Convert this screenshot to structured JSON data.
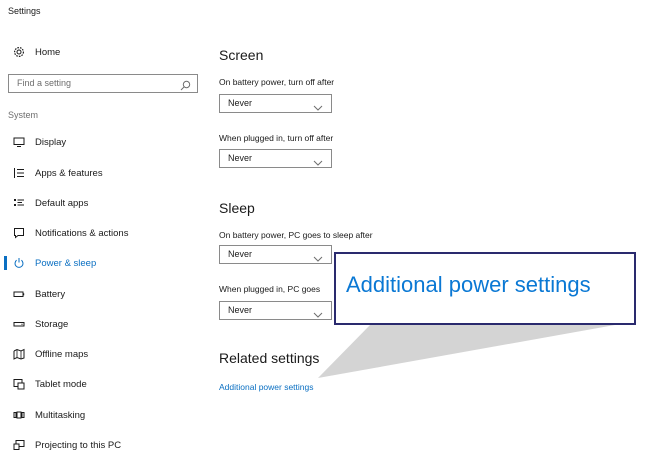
{
  "window": {
    "title": "Settings"
  },
  "sidebar": {
    "home_label": "Home",
    "search_placeholder": "Find a setting",
    "section_label": "System",
    "items": [
      {
        "label": "Display",
        "icon": "monitor-icon"
      },
      {
        "label": "Apps & features",
        "icon": "list-icon"
      },
      {
        "label": "Default apps",
        "icon": "default-apps-icon"
      },
      {
        "label": "Notifications & actions",
        "icon": "notification-icon"
      },
      {
        "label": "Power & sleep",
        "icon": "power-icon",
        "active": true
      },
      {
        "label": "Battery",
        "icon": "battery-icon"
      },
      {
        "label": "Storage",
        "icon": "storage-icon"
      },
      {
        "label": "Offline maps",
        "icon": "map-icon"
      },
      {
        "label": "Tablet mode",
        "icon": "tablet-icon"
      },
      {
        "label": "Multitasking",
        "icon": "multitasking-icon"
      },
      {
        "label": "Projecting to this PC",
        "icon": "projecting-icon"
      }
    ]
  },
  "main": {
    "screen": {
      "heading": "Screen",
      "battery_label": "On battery power, turn off after",
      "battery_value": "Never",
      "plugged_label": "When plugged in, turn off after",
      "plugged_value": "Never"
    },
    "sleep": {
      "heading": "Sleep",
      "battery_label": "On battery power, PC goes to sleep after",
      "battery_value": "Never",
      "plugged_label": "When plugged in, PC goes",
      "plugged_value": "Never"
    },
    "related": {
      "heading": "Related settings",
      "link": "Additional power settings"
    }
  },
  "callout": {
    "text": "Additional power settings"
  },
  "colors": {
    "accent": "#0a6fc2",
    "callout_border": "#2a2a6e",
    "callout_text": "#0a78d4"
  }
}
